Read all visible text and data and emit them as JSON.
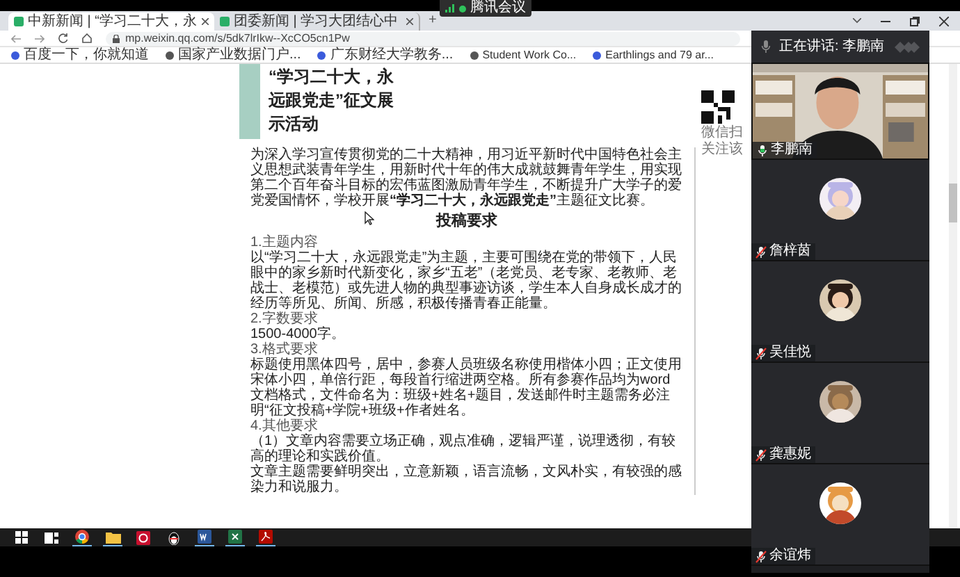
{
  "meeting_badge": {
    "title": "腾讯会议"
  },
  "browser": {
    "tabs": [
      {
        "title": "中新新闻 | “学习二十大，永",
        "selected": true
      },
      {
        "title": "团委新闻 | 学习大团结心中",
        "selected": false
      }
    ],
    "new_tab": "+",
    "url": "mp.weixin.qq.com/s/5dk7lrIkw--XcCO5cn1Pw",
    "bookmarks": [
      "百度一下，你就知道",
      "国家产业数据门户...",
      "广东财经大学教务...",
      "Student Work Co...",
      "Earthlings and 79 ar..."
    ]
  },
  "article": {
    "title": "“学习二十大，永远跟党走”征文展示活动",
    "intro": "为深入学习宣传贯彻党的二十大精神，用习近平新时代中国特色社会主义思想武装青年学生，用新时代十年的伟大成就鼓舞青年学生，用实现第二个百年奋斗目标的宏伟蓝图激励青年学生，不断提升广大学子的爱党爱国情怀，学校开展**“学习二十大，永远跟党走”**主题征文比赛。",
    "heading": "投稿要求",
    "lines": [
      {
        "kind": "label",
        "text": "1.主题内容"
      },
      {
        "kind": "body",
        "text": "以“学习二十大，永远跟党走”为主题，主要可围绕在党的带领下，人民眼中的家乡新时代新变化，家乡“五老”（老党员、老专家、老教师、老战士、老模范）或先进人物的典型事迹访谈，学生本人自身成长成才的经历等所见、所闻、所感，积极传播青春正能量。"
      },
      {
        "kind": "label",
        "text": "2.字数要求"
      },
      {
        "kind": "body",
        "text": "1500-4000字。"
      },
      {
        "kind": "label",
        "text": "3.格式要求"
      },
      {
        "kind": "body",
        "text": "标题使用黑体四号，居中，参赛人员班级名称使用楷体小四；正文使用宋体小四，单倍行距，每段首行缩进两空格。所有参赛作品均为word文档格式，文件命名为：班级+姓名+题目，发送邮件时主题需务必注明“征文投稿+学院+班级+作者姓名。"
      },
      {
        "kind": "label",
        "text": "4.其他要求"
      },
      {
        "kind": "body",
        "text": "（1）文章内容需要立场正确，观点准确，逻辑严谨，说理透彻，有较高的理论和实践价值。"
      },
      {
        "kind": "body",
        "text": "文章主题需要鲜明突出，立意新颖，语言流畅，文风朴实，有较强的感染力和说服力。"
      }
    ],
    "qr_caption": [
      "微信扫",
      "关注该"
    ]
  },
  "meeting": {
    "speaking_label": "正在讲话: 李鹏南",
    "participants": [
      {
        "name": "李鹏南",
        "kind": "video",
        "muted": false,
        "speaking": true
      },
      {
        "name": "詹梓茵",
        "kind": "avatar",
        "muted": true,
        "speaking": false
      },
      {
        "name": "吴佳悦",
        "kind": "avatar",
        "muted": true,
        "speaking": false
      },
      {
        "name": "龚惠妮",
        "kind": "avatar",
        "muted": true,
        "speaking": false
      },
      {
        "name": "余谊炜",
        "kind": "avatar",
        "muted": true,
        "speaking": false
      }
    ]
  },
  "taskbar": [
    {
      "kind": "start",
      "running": false
    },
    {
      "kind": "taskview",
      "running": false
    },
    {
      "kind": "browser",
      "running": true
    },
    {
      "kind": "folder",
      "running": true
    },
    {
      "kind": "redapp",
      "running": false
    },
    {
      "kind": "penguin",
      "running": false
    },
    {
      "kind": "word",
      "running": true
    },
    {
      "kind": "excel",
      "running": true
    },
    {
      "kind": "pdf",
      "running": true
    }
  ]
}
